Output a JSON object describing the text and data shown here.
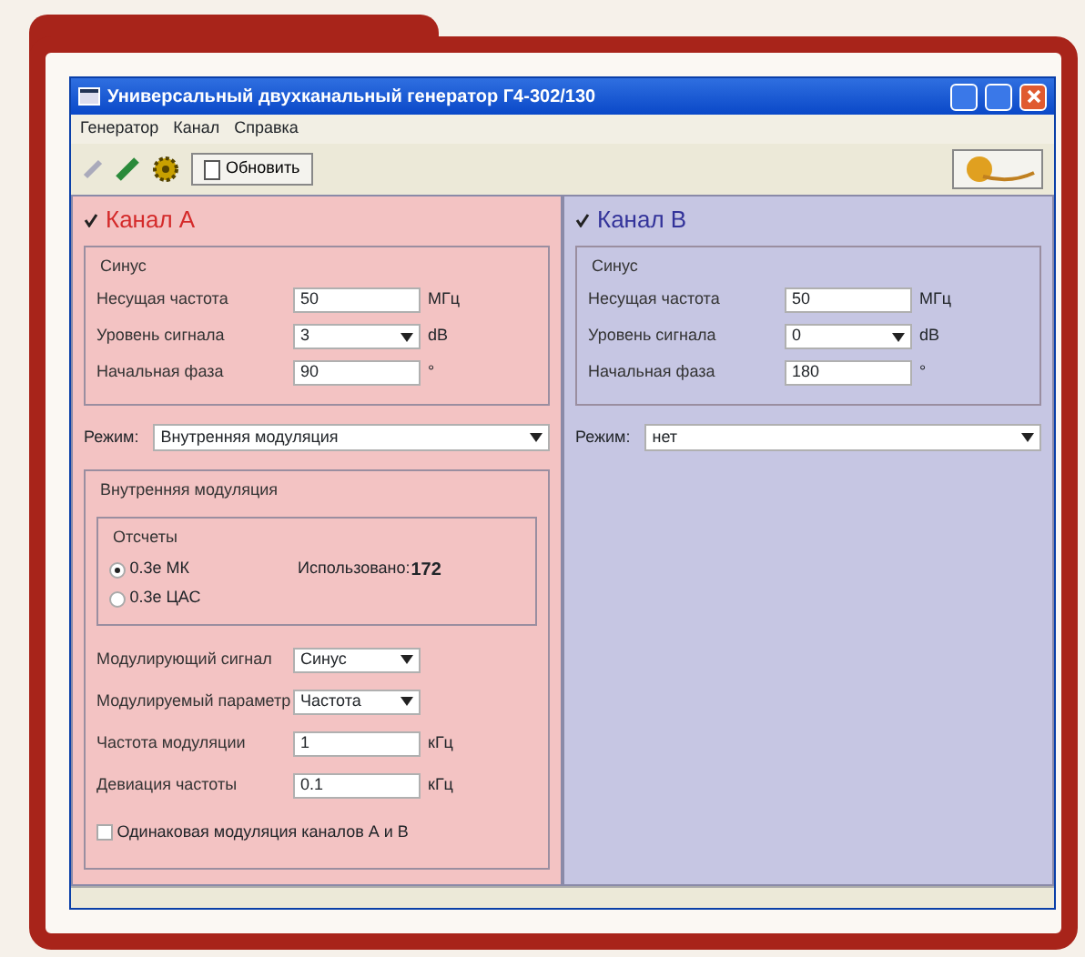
{
  "window": {
    "title": "Универсальный двухканальный генератор Г4-302/130"
  },
  "menu": [
    "Генератор",
    "Канал",
    "Справка"
  ],
  "toolbar": {
    "refresh_button": "Обновить"
  },
  "channels": [
    {
      "title": "Канал А",
      "enabled": true,
      "color": "#d42a2a",
      "sine": {
        "title": "Синус",
        "fields": [
          {
            "kind": "input",
            "label": "Несущая частота",
            "value": "50",
            "unit": "МГц"
          },
          {
            "kind": "select",
            "label": "Уровень сигнала",
            "value": "3",
            "unit": "dB"
          },
          {
            "kind": "input",
            "label": "Начальная фаза",
            "value": "90",
            "unit": "°"
          }
        ]
      },
      "mode": {
        "label": "Режим:",
        "value": "Внутренняя модуляция"
      },
      "modulation": {
        "title": "Внутренняя модуляция",
        "samples": {
          "title": "Отсчеты",
          "options": [
            {
              "label": "0.3е МК",
              "selected": true
            },
            {
              "label": "0.3е ЦАС",
              "selected": false
            }
          ],
          "used_label": "Использовано:",
          "used_value": "172"
        },
        "fields": [
          {
            "kind": "select",
            "label": "Модулирующий сигнал",
            "value": "Синус"
          },
          {
            "kind": "select",
            "label": "Модулируемый параметр",
            "value": "Частота"
          },
          {
            "kind": "input",
            "label": "Частота модуляции",
            "value": "1",
            "unit": "кГц"
          },
          {
            "kind": "input",
            "label": "Девиация частоты",
            "value": "0.1",
            "unit": "кГц"
          }
        ],
        "same_checkbox": {
          "label": "Одинаковая модуляция каналов А и В",
          "checked": false
        }
      }
    },
    {
      "title": "Канал В",
      "enabled": true,
      "color": "#33339a",
      "sine": {
        "title": "Синус",
        "fields": [
          {
            "kind": "input",
            "label": "Несущая частота",
            "value": "50",
            "unit": "МГц"
          },
          {
            "kind": "select",
            "label": "Уровень сигнала",
            "value": "0",
            "unit": "dB"
          },
          {
            "kind": "input",
            "label": "Начальная фаза",
            "value": "180",
            "unit": "°"
          }
        ]
      },
      "mode": {
        "label": "Режим:",
        "value": "нет"
      }
    }
  ]
}
